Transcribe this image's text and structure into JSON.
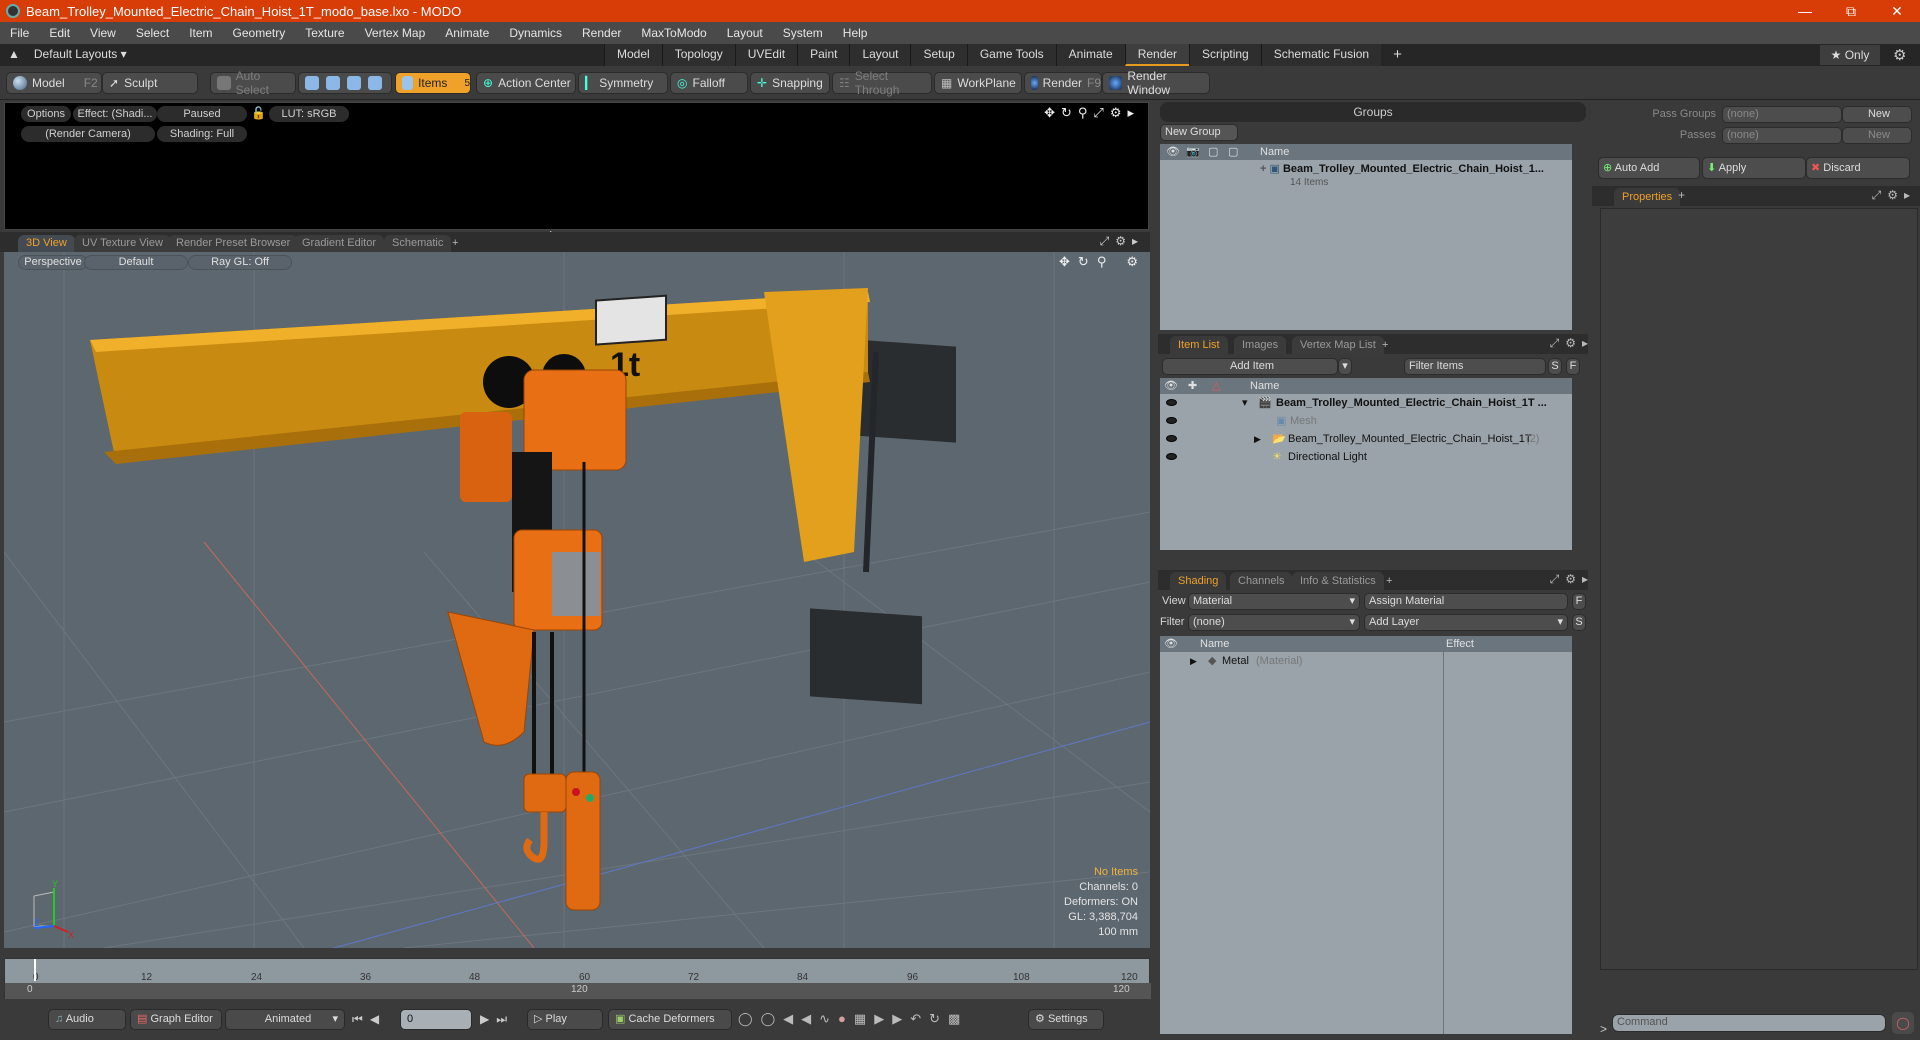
{
  "window": {
    "title": "Beam_Trolley_Mounted_Electric_Chain_Hoist_1T_modo_base.lxo - MODO",
    "controls": [
      "minimize",
      "restore",
      "close"
    ]
  },
  "menu": [
    "File",
    "Edit",
    "View",
    "Select",
    "Item",
    "Geometry",
    "Texture",
    "Vertex Map",
    "Animate",
    "Dynamics",
    "Render",
    "MaxToModo",
    "Layout",
    "System",
    "Help"
  ],
  "layoutbar": {
    "layouts_label": "Default Layouts ▾",
    "tabs": [
      "Model",
      "Topology",
      "UVEdit",
      "Paint",
      "Layout",
      "Setup",
      "Game Tools",
      "Animate",
      "Render",
      "Scripting",
      "Schematic Fusion",
      "+"
    ],
    "active_tab": "Render",
    "only_label": "★ Only"
  },
  "toolbar": {
    "model": "Model",
    "model_key": "F2",
    "sculpt": "Sculpt",
    "auto_select": "Auto Select",
    "items": "Items",
    "items_count": "5",
    "action_center": "Action Center",
    "symmetry": "Symmetry",
    "falloff": "Falloff",
    "snapping": "Snapping",
    "select_through": "Select Through",
    "workplane": "WorkPlane",
    "render": "Render",
    "render_key": "F9",
    "render_window": "Render Window"
  },
  "render_preview": {
    "options": "Options",
    "effect": "Effect: (Shadi...",
    "paused": "Paused",
    "lut": "LUT: sRGB",
    "camera": "(Render Camera)",
    "shading": "Shading: Full"
  },
  "viewport_tabs": [
    "3D View",
    "UV Texture View",
    "Render Preset Browser",
    "Gradient Editor",
    "Schematic",
    "+"
  ],
  "viewport": {
    "projection": "Perspective",
    "style": "Default",
    "raygl": "Ray GL: Off",
    "sign_text": "1t",
    "hud": {
      "selection": "No Items",
      "channels": "Channels: 0",
      "deformers": "Deformers: ON",
      "gl": "GL: 3,388,704",
      "scale": "100 mm"
    },
    "axis_labels": {
      "x": "X",
      "y": "Y",
      "z": "Z"
    }
  },
  "timeline": {
    "ticks": [
      "0",
      "12",
      "24",
      "36",
      "48",
      "60",
      "72",
      "84",
      "96",
      "108",
      "120"
    ],
    "range_start": "0",
    "range_mid": "120",
    "range_end": "120",
    "current_frame": 0
  },
  "bottombar": {
    "audio": "Audio",
    "graph_editor": "Graph Editor",
    "animated": "Animated",
    "frame": "0",
    "play": "Play",
    "cache_deformers": "Cache Deformers",
    "settings": "Settings"
  },
  "groups": {
    "title": "Groups",
    "new_group": "New Group",
    "col_name": "Name",
    "item_name": "Beam_Trolley_Mounted_Electric_Chain_Hoist_1...",
    "item_count": "14 Items"
  },
  "passes": {
    "pass_groups_label": "Pass Groups",
    "pass_groups_value": "(none)",
    "passes_label": "Passes",
    "passes_value": "(none)",
    "new": "New",
    "auto_add": "Auto Add",
    "apply": "Apply",
    "discard": "Discard",
    "properties_tab": "Properties"
  },
  "item_list": {
    "tabs": [
      "Item List",
      "Images",
      "Vertex Map List",
      "+"
    ],
    "add_item": "Add Item",
    "filter_placeholder": "Filter Items",
    "s": "S",
    "f": "F",
    "col_name": "Name",
    "rows": [
      {
        "name": "Beam_Trolley_Mounted_Electric_Chain_Hoist_1T ...",
        "suffix": "",
        "bold": true
      },
      {
        "name": "Mesh",
        "suffix": "",
        "dim": true
      },
      {
        "name": "Beam_Trolley_Mounted_Electric_Chain_Hoist_1T",
        "suffix": "(2)"
      },
      {
        "name": "Directional Light",
        "suffix": ""
      }
    ]
  },
  "shading": {
    "tabs": [
      "Shading",
      "Channels",
      "Info & Statistics",
      "+"
    ],
    "view_label": "View",
    "view_value": "Material",
    "assign_material": "Assign Material",
    "filter_label": "Filter",
    "filter_value": "(none)",
    "add_layer": "Add Layer",
    "f": "F",
    "s": "S",
    "col_name": "Name",
    "col_effect": "Effect",
    "rows": [
      {
        "name": "Metal",
        "type": "(Material)"
      }
    ]
  },
  "command": {
    "prompt": ">",
    "placeholder": "Command"
  },
  "colors": {
    "accent": "#f0a12a",
    "titlebar": "#d83c07",
    "beam": "#e3a21a",
    "hoist": "#e86f14"
  }
}
